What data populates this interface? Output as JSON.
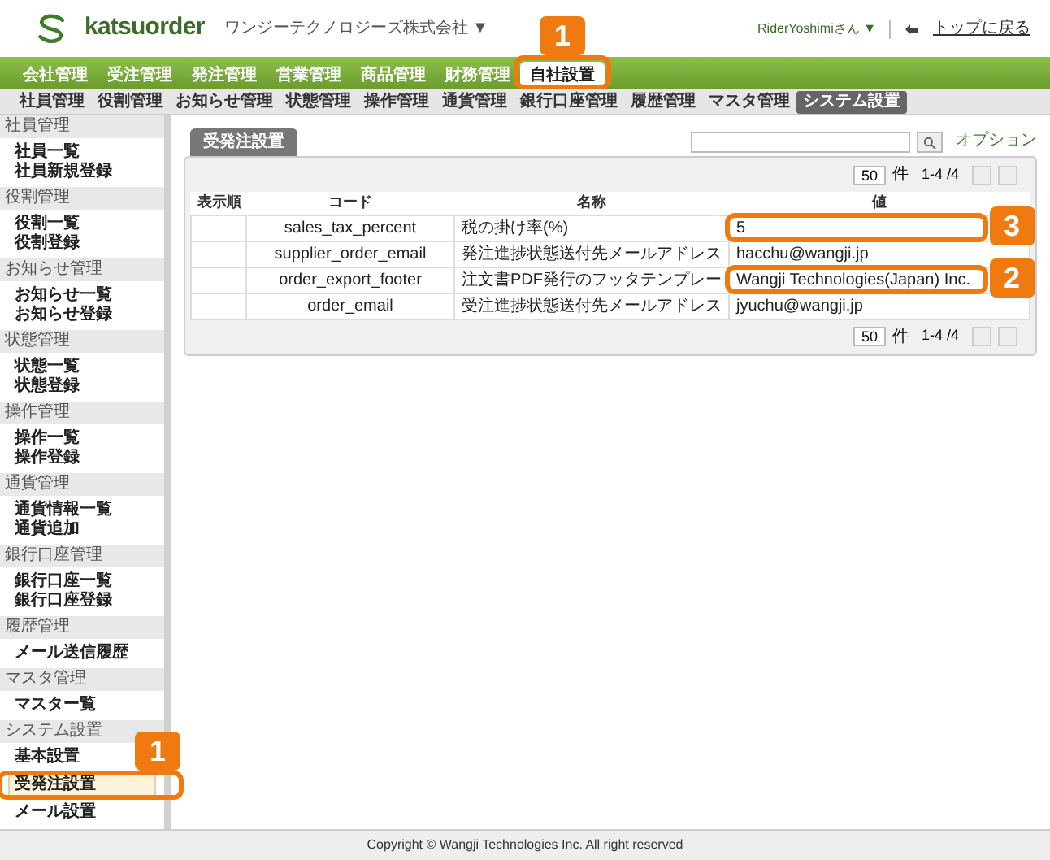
{
  "header": {
    "logo": "katsuorder",
    "company": "ワンジーテクノロジーズ株式会社 ▼",
    "user": "RiderYoshimiさん ▼",
    "back_link": "トップに戻る"
  },
  "main_nav": [
    {
      "label": "会社管理",
      "selected": false
    },
    {
      "label": "受注管理",
      "selected": false
    },
    {
      "label": "発注管理",
      "selected": false
    },
    {
      "label": "営業管理",
      "selected": false
    },
    {
      "label": "商品管理",
      "selected": false
    },
    {
      "label": "財務管理",
      "selected": false
    },
    {
      "label": "自社設置",
      "selected": true
    }
  ],
  "sub_nav": [
    {
      "label": "社員管理",
      "selected": false
    },
    {
      "label": "役割管理",
      "selected": false
    },
    {
      "label": "お知らせ管理",
      "selected": false
    },
    {
      "label": "状態管理",
      "selected": false
    },
    {
      "label": "操作管理",
      "selected": false
    },
    {
      "label": "通貨管理",
      "selected": false
    },
    {
      "label": "銀行口座管理",
      "selected": false
    },
    {
      "label": "履歴管理",
      "selected": false
    },
    {
      "label": "マスタ管理",
      "selected": false
    },
    {
      "label": "システム設置",
      "selected": true
    }
  ],
  "sidebar": [
    {
      "title": "社員管理",
      "items": [
        {
          "label": "社員一覧",
          "selected": false
        },
        {
          "label": "社員新規登録",
          "selected": false
        }
      ]
    },
    {
      "title": "役割管理",
      "items": [
        {
          "label": "役割一覧",
          "selected": false
        },
        {
          "label": "役割登録",
          "selected": false
        }
      ]
    },
    {
      "title": "お知らせ管理",
      "items": [
        {
          "label": "お知らせ一覧",
          "selected": false
        },
        {
          "label": "お知らせ登録",
          "selected": false
        }
      ]
    },
    {
      "title": "状態管理",
      "items": [
        {
          "label": "状態一覧",
          "selected": false
        },
        {
          "label": "状態登録",
          "selected": false
        }
      ]
    },
    {
      "title": "操作管理",
      "items": [
        {
          "label": "操作一覧",
          "selected": false
        },
        {
          "label": "操作登録",
          "selected": false
        }
      ]
    },
    {
      "title": "通貨管理",
      "items": [
        {
          "label": "通貨情報一覧",
          "selected": false
        },
        {
          "label": "通貨追加",
          "selected": false
        }
      ]
    },
    {
      "title": "銀行口座管理",
      "items": [
        {
          "label": "銀行口座一覧",
          "selected": false
        },
        {
          "label": "銀行口座登録",
          "selected": false
        }
      ]
    },
    {
      "title": "履歴管理",
      "items": [
        {
          "label": "メール送信履歴",
          "selected": false
        }
      ]
    },
    {
      "title": "マスタ管理",
      "items": [
        {
          "label": "マスター覧",
          "selected": false
        }
      ]
    },
    {
      "title": "システム設置",
      "items": [
        {
          "label": "基本設置",
          "selected": false
        },
        {
          "label": "受発注設置",
          "selected": true
        },
        {
          "label": "メール設置",
          "selected": false
        }
      ]
    }
  ],
  "content": {
    "tab": "受発注設置",
    "search": {
      "option_link": "オプション"
    },
    "pager_top": {
      "per_page": "50",
      "unit": "件",
      "range": "1-4 /4"
    },
    "table": {
      "columns": [
        "表示順",
        "コード",
        "名称",
        "値"
      ],
      "rows": [
        [
          "",
          "sales_tax_percent",
          "税の掛け率(%)",
          "5"
        ],
        [
          "",
          "supplier_order_email",
          "発注進捗状態送付先メールアドレス",
          "hacchu@wangji.jp"
        ],
        [
          "",
          "order_export_footer",
          "注文書PDF発行のフッタテンプレー",
          "Wangji Technologies(Japan) Inc."
        ],
        [
          "",
          "order_email",
          "受注進捗状態送付先メールアドレス",
          "jyuchu@wangji.jp"
        ]
      ]
    },
    "pager_bottom": {
      "per_page": "50",
      "unit": "件",
      "range": "1-4 /4"
    }
  },
  "footer": "Copyright © Wangji Technologies Inc. All right reserved",
  "callouts": [
    {
      "number": "1"
    },
    {
      "number": "1"
    },
    {
      "number": "3"
    },
    {
      "number": "2"
    }
  ]
}
